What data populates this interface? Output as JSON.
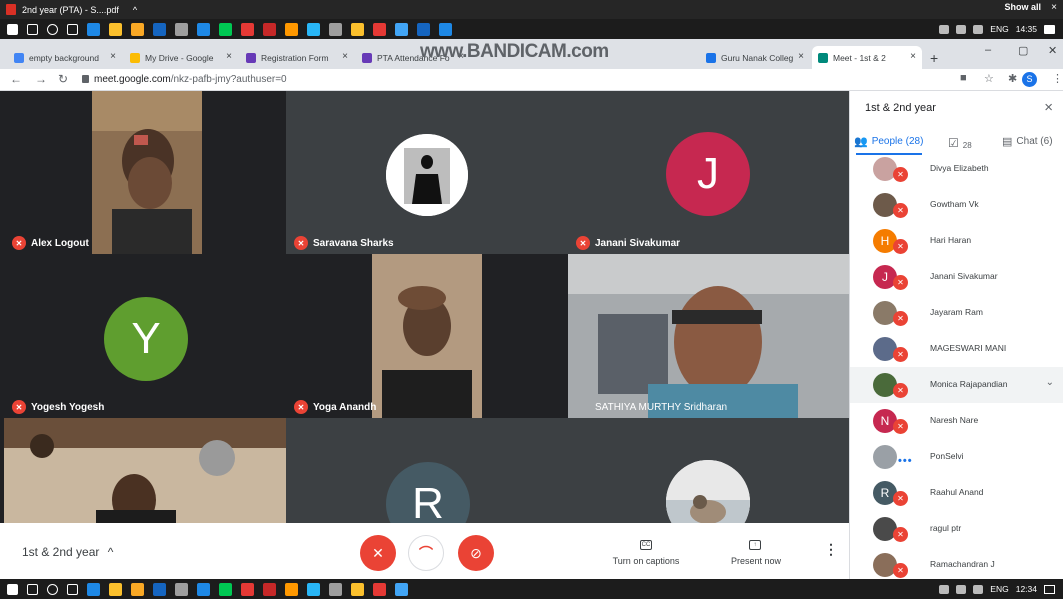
{
  "top_download_bar": {
    "file": "2nd year (PTA) - S....pdf",
    "caret": "^",
    "show_all": "Show all",
    "close": "×"
  },
  "taskbar_top": {
    "lang": "ENG",
    "time": "14:35"
  },
  "taskbar_bottom": {
    "lang": "ENG",
    "time": "12:34"
  },
  "browser": {
    "tabs": [
      {
        "label": "empty background",
        "color": "#4285f4"
      },
      {
        "label": "My Drive - Google",
        "color": "#fbbc04"
      },
      {
        "label": "Registration Form",
        "color": "#673ab7"
      },
      {
        "label": "PTA Attendance Fo",
        "color": "#673ab7"
      },
      {
        "label": "Guru Nanak Colleg",
        "color": "#1a73e8"
      },
      {
        "label": "Meet - 1st & 2",
        "color": "#00897b"
      }
    ],
    "watermark": "www.BANDICAM.com",
    "new_tab": "+",
    "url_domain": "meet.google.com",
    "url_path": "/nkz-pafb-jmy?authuser=0",
    "profile_initial": "S"
  },
  "tiles": [
    {
      "name": "Alex Logout"
    },
    {
      "name": "Saravana Sharks"
    },
    {
      "name": "Janani Sivakumar",
      "initial": "J",
      "color": "#c62850"
    },
    {
      "name": "Yogesh Yogesh",
      "initial": "Y",
      "color": "#5f9e2f"
    },
    {
      "name": "Yoga Anandh"
    },
    {
      "name": "SATHIYA MURTHY Sridharan"
    },
    {
      "name": ""
    },
    {
      "name": "",
      "initial": "R",
      "color": "#455a64"
    },
    {
      "name": ""
    }
  ],
  "bottom_bar": {
    "meeting_name": "1st & 2nd year",
    "caret": "^",
    "captions_label": "Turn on captions",
    "captions_icon": "CC",
    "present_label": "Present now",
    "more": "⋮"
  },
  "panel": {
    "title": "1st & 2nd year",
    "close": "×",
    "people_tab": "People (28)",
    "tasks_count": "28",
    "chat_tab": "Chat (6)",
    "people": [
      {
        "name": "Divya Elizabeth",
        "color": "#c9a2a0"
      },
      {
        "name": "Gowtham Vk",
        "color": "#6d5a4a"
      },
      {
        "name": "Hari Haran",
        "initial": "H",
        "color": "#f57c00"
      },
      {
        "name": "Janani Sivakumar",
        "initial": "J",
        "color": "#c62850"
      },
      {
        "name": "Jayaram Ram",
        "color": "#8a7a68"
      },
      {
        "name": "MAGESWARI MANI",
        "color": "#5c6b8a"
      },
      {
        "name": "Monica Rajapandian",
        "color": "#4a6a3a",
        "chevron": "⌄"
      },
      {
        "name": "Naresh Nare",
        "initial": "N",
        "color": "#c62850"
      },
      {
        "name": "PonSelvi",
        "color": "#9aa0a6",
        "dots": "•••"
      },
      {
        "name": "Raahul Anand",
        "initial": "R",
        "color": "#455a64"
      },
      {
        "name": "ragul ptr",
        "color": "#4a4a4a"
      },
      {
        "name": "Ramachandran J",
        "color": "#8a6e5a"
      }
    ]
  }
}
